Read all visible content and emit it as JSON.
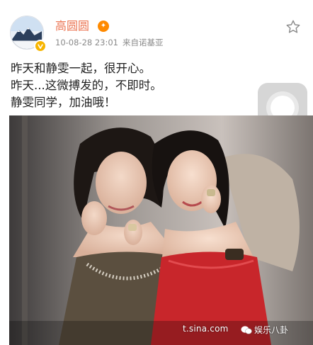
{
  "post": {
    "author": {
      "name": "高圆圆",
      "avatar_icon": "avatar-mountain-icon",
      "verified_icon": "verified-v-icon",
      "member_icon": "vip-member-icon"
    },
    "meta": {
      "timestamp": "10-08-28 23:01",
      "source": "来自诺基亚"
    },
    "actions": {
      "favorite_icon": "star-outline-icon"
    },
    "content": {
      "lines": [
        "昨天和静雯一起，很开心。",
        "昨天...这微搏发的，不即时。",
        "静雯同学，加油哦！"
      ]
    },
    "image": {
      "watermark_url": "t.sina.com",
      "watermark_brand": "娱乐八卦"
    }
  },
  "colors": {
    "username": "#eb7350",
    "text": "#1f1f1f",
    "meta": "#8a8a8a",
    "verified": "#f7b500",
    "dress_red": "#c8262b"
  }
}
